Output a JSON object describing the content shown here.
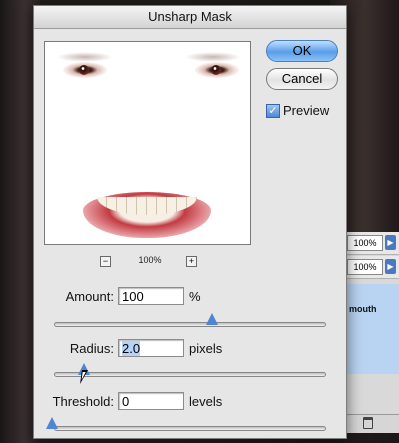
{
  "dialog": {
    "title": "Unsharp Mask"
  },
  "buttons": {
    "ok": "OK",
    "cancel": "Cancel"
  },
  "preview_option": {
    "label": "Preview",
    "checked": true
  },
  "zoom": {
    "out_symbol": "−",
    "level": "100%",
    "in_symbol": "+"
  },
  "amount": {
    "label": "Amount:",
    "value": "100",
    "unit": "%",
    "slider_level": 0.62
  },
  "radius": {
    "label": "Radius:",
    "value": "2.0",
    "unit": "pixels",
    "slider_level": 0.1
  },
  "threshold": {
    "label": "Threshold:",
    "value": "0",
    "unit": "levels",
    "slider_level": 0.0
  },
  "palette": {
    "opacity_1": "100%",
    "opacity_2": "100%",
    "layer_name": "mouth",
    "arrow_symbol": "▶"
  },
  "colors": {
    "accent": "#4f85d3",
    "ok_button": "#5a9ee8",
    "dialog_bg": "#e6e6e6"
  },
  "icons": [
    "zoom-out-icon",
    "zoom-in-icon",
    "checkbox-icon",
    "slider-thumb-icon",
    "pointer-cursor-icon",
    "trash-icon"
  ]
}
